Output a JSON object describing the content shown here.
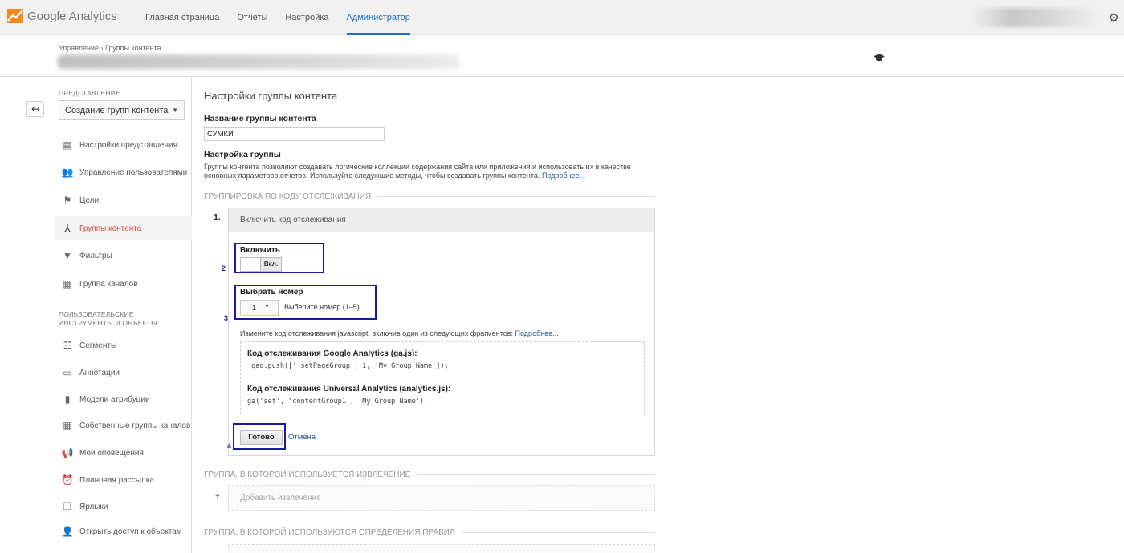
{
  "topbar": {
    "app_name": "Google Analytics",
    "nav": [
      {
        "label": "Главная страница"
      },
      {
        "label": "Отчеты"
      },
      {
        "label": "Настройка"
      },
      {
        "label": "Администратор"
      }
    ],
    "active_nav": "Администратор"
  },
  "header": {
    "breadcrumb": "Управление › Группы контента"
  },
  "sidebar": {
    "view_label": "ПРЕДСТАВЛЕНИЕ",
    "view_select": "Создание групп контента",
    "items": [
      {
        "label": "Настройки представления",
        "icon": "document-icon"
      },
      {
        "label": "Управление пользователями",
        "icon": "users-icon"
      },
      {
        "label": "Цели",
        "icon": "flag-icon"
      },
      {
        "label": "Группы контента",
        "icon": "content-group-icon"
      },
      {
        "label": "Фильтры",
        "icon": "filter-icon"
      },
      {
        "label": "Группа каналов",
        "icon": "channel-icon"
      }
    ],
    "tools_label": "ПОЛЬЗОВАТЕЛЬСКИЕ ИНСТРУМЕНТЫ И ОБЪЕКТЫ",
    "tools": [
      {
        "label": "Сегменты",
        "icon": "segments-icon"
      },
      {
        "label": "Аннотации",
        "icon": "annotation-icon"
      },
      {
        "label": "Модели атрибуции",
        "icon": "bar-chart-icon"
      },
      {
        "label": "Собственные группы каналов",
        "icon": "custom-channel-icon"
      },
      {
        "label": "Мои оповещения",
        "icon": "megaphone-icon"
      },
      {
        "label": "Плановая рассылка",
        "icon": "clock-icon"
      },
      {
        "label": "Ярлыки",
        "icon": "shortcut-icon"
      },
      {
        "label": "Открыть доступ к объектам",
        "icon": "share-user-icon"
      }
    ],
    "active_item": "Группы контента"
  },
  "content": {
    "title": "Настройки группы контента",
    "name_label": "Название группы контента",
    "name_value": "СУМКИ",
    "group_label": "Настройка группы",
    "desc": "Группы контента позволяют создавать логические коллекции содержания сайта или приложения и использовать их в качестве основных параметров отчетов. Используйте следующие методы, чтобы создавать группы контента.",
    "desc_link": "Подробнее...",
    "section1": "ГРУППИРОВКА ПО КОДУ ОТСЛЕЖИВАНИЯ",
    "step1": "1.",
    "panel_head": "Включить код отслеживания",
    "enable_label": "Включить",
    "toggle_on": "Вкл.",
    "choose_label": "Выбрать номер",
    "number_value": "1",
    "number_hint": "Выберите номер (1–5).",
    "tracking_text": "Измените код отслеживания javascript, включив один из следующих фрагментов:",
    "tracking_link": "Подробнее...",
    "ga_title": "Код отслеживания Google Analytics (ga.js):",
    "ga_code": "_gaq.push(['_setPageGroup', 1, 'My Group Name']);",
    "ua_title": "Код отслеживания Universal Analytics (analytics.js):",
    "ua_code": "ga('set', 'contentGroup1', 'My Group Name');",
    "done_btn": "Готово",
    "cancel": "Отмена",
    "section2": "ГРУППА, В КОТОРОЙ ИСПОЛЬЗУЕТСЯ ИЗВЛЕЧЕНИЕ",
    "add_extraction": "Добавить извлечение",
    "plus": "+",
    "section3": "ГРУППА, В КОТОРОЙ ИСПОЛЬЗУЮТСЯ ОПРЕДЕЛЕНИЯ ПРАВИЛ",
    "annotations": [
      "2",
      "3",
      "4"
    ]
  },
  "colors": {
    "accent": "#1a73c7",
    "active_sidebar": "#dd4b39",
    "highlight_box": "#1a1aa0"
  }
}
